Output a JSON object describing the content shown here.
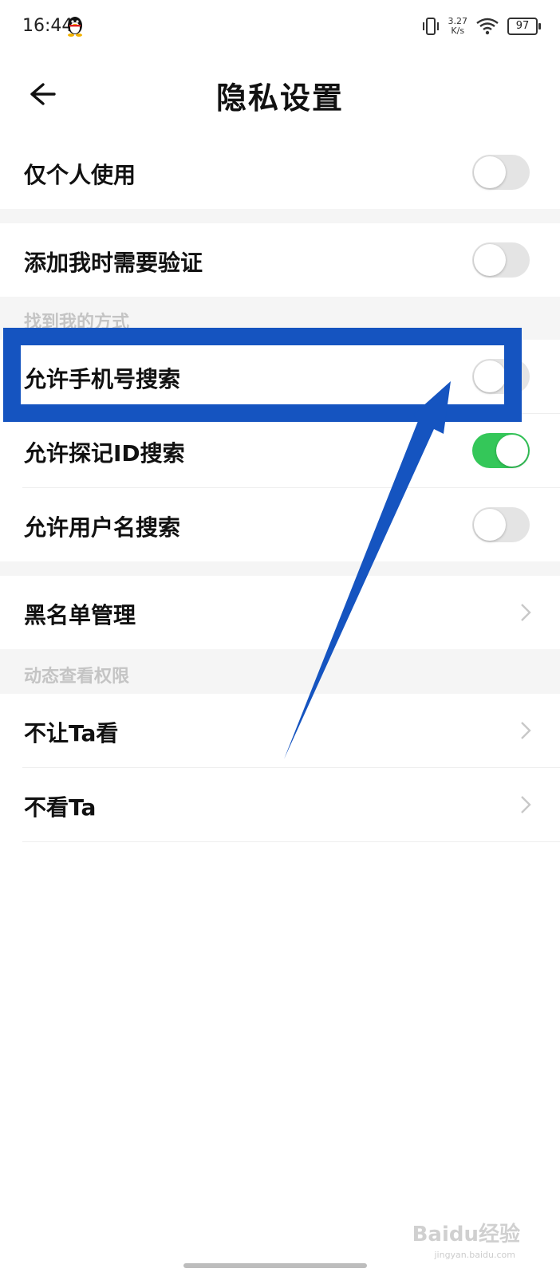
{
  "status_bar": {
    "time": "16:44",
    "speed_value": "3.27",
    "speed_unit": "K/s",
    "battery": "97"
  },
  "header": {
    "title": "隐私设置"
  },
  "rows": {
    "personal_only": {
      "label": "仅个人使用",
      "on": false
    },
    "verify_add": {
      "label": "添加我时需要验证",
      "on": false
    },
    "find_section": "找到我的方式",
    "phone_search": {
      "label": "允许手机号搜索",
      "on": false
    },
    "id_search": {
      "label": "允许探记ID搜索",
      "on": true
    },
    "username_search": {
      "label": "允许用户名搜索",
      "on": false
    },
    "blacklist": {
      "label": "黑名单管理"
    },
    "feed_section": "动态查看权限",
    "dont_let_see": {
      "label": "不让Ta看"
    },
    "dont_see": {
      "label": "不看Ta"
    }
  },
  "watermark": {
    "logo": "Baidu经验",
    "url": "jingyan.baidu.com"
  },
  "colors": {
    "toggle_on": "#34c759",
    "toggle_off": "#e4e4e4",
    "annotation": "#1554c0"
  }
}
